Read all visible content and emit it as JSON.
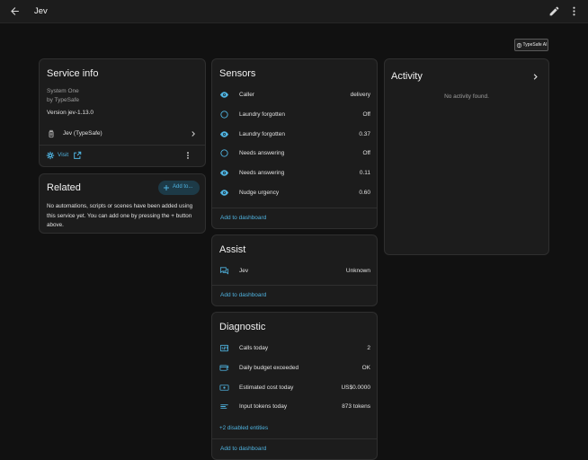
{
  "header": {
    "title": "Jev"
  },
  "badge": {
    "label": "TypeSafe AI"
  },
  "service_info": {
    "title": "Service info",
    "model": "System One",
    "manufacturer": "by TypeSafe",
    "version": "Version jev-1.13.0",
    "device": "Jev (TypeSafe)",
    "visit": "Visit"
  },
  "related": {
    "title": "Related",
    "add_button": "Add to...",
    "text": "No automations, scripts or scenes have been added using this service yet. You can add one by pressing the + button above."
  },
  "sensors": {
    "title": "Sensors",
    "rows": [
      {
        "icon": "eye-icon",
        "label": "Caller",
        "value": "delivery"
      },
      {
        "icon": "circle-outline-icon",
        "label": "Laundry forgotten",
        "value": "Off"
      },
      {
        "icon": "eye-icon",
        "label": "Laundry forgotten",
        "value": "0.37"
      },
      {
        "icon": "circle-outline-icon",
        "label": "Needs answering",
        "value": "Off"
      },
      {
        "icon": "eye-icon",
        "label": "Needs answering",
        "value": "0.11"
      },
      {
        "icon": "eye-icon",
        "label": "Nudge urgency",
        "value": "0.60"
      }
    ],
    "add_label": "Add to dashboard"
  },
  "assist": {
    "title": "Assist",
    "rows": [
      {
        "icon": "chat-icon",
        "label": "Jev",
        "value": "Unknown"
      }
    ],
    "add_label": "Add to dashboard"
  },
  "diagnostic": {
    "title": "Diagnostic",
    "rows": [
      {
        "icon": "counter-icon",
        "label": "Calls today",
        "value": "2"
      },
      {
        "icon": "card-alert-icon",
        "label": "Daily budget exceeded",
        "value": "OK"
      },
      {
        "icon": "cash-icon",
        "label": "Estimated cost today",
        "value": "US$0.0000"
      },
      {
        "icon": "text-lines-icon",
        "label": "Input tokens today",
        "value": "873 tokens"
      }
    ],
    "disabled": "+2 disabled entities",
    "add_label": "Add to dashboard"
  },
  "activity": {
    "title": "Activity",
    "empty": "No activity found."
  },
  "colors": {
    "accent": "#4fb3e0",
    "card": "#1c1c1c",
    "background": "#111111"
  }
}
